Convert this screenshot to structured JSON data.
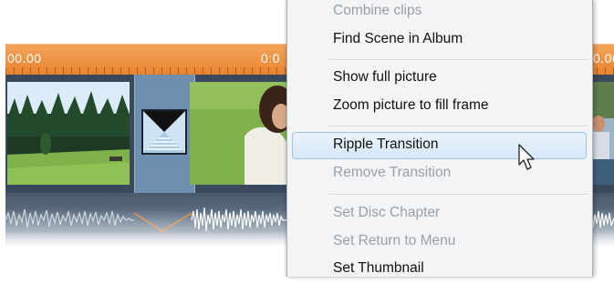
{
  "timeline": {
    "ruler_labels": [
      "00.00",
      "0:0",
      "0.00"
    ]
  },
  "context_menu": {
    "items": [
      {
        "label": "Combine clips",
        "disabled": true
      },
      {
        "label": "Find Scene in Album",
        "disabled": false
      },
      {
        "label": "Show full picture",
        "disabled": false
      },
      {
        "label": "Zoom picture to fill frame",
        "disabled": false
      },
      {
        "label": "Ripple Transition",
        "disabled": false,
        "hovered": true
      },
      {
        "label": "Remove Transition",
        "disabled": true
      },
      {
        "label": "Set Disc Chapter",
        "disabled": true
      },
      {
        "label": "Set Return to Menu",
        "disabled": true
      },
      {
        "label": "Set Thumbnail",
        "disabled": false
      }
    ]
  },
  "colors": {
    "ruler": "#e7832f",
    "track": "#3a4a5c",
    "transition": "#6f8fb0",
    "menu_bg": "#f2f4f6",
    "hover_border": "#9cc4e8"
  },
  "icons": [
    "transition-icon",
    "mouse-cursor-icon"
  ]
}
